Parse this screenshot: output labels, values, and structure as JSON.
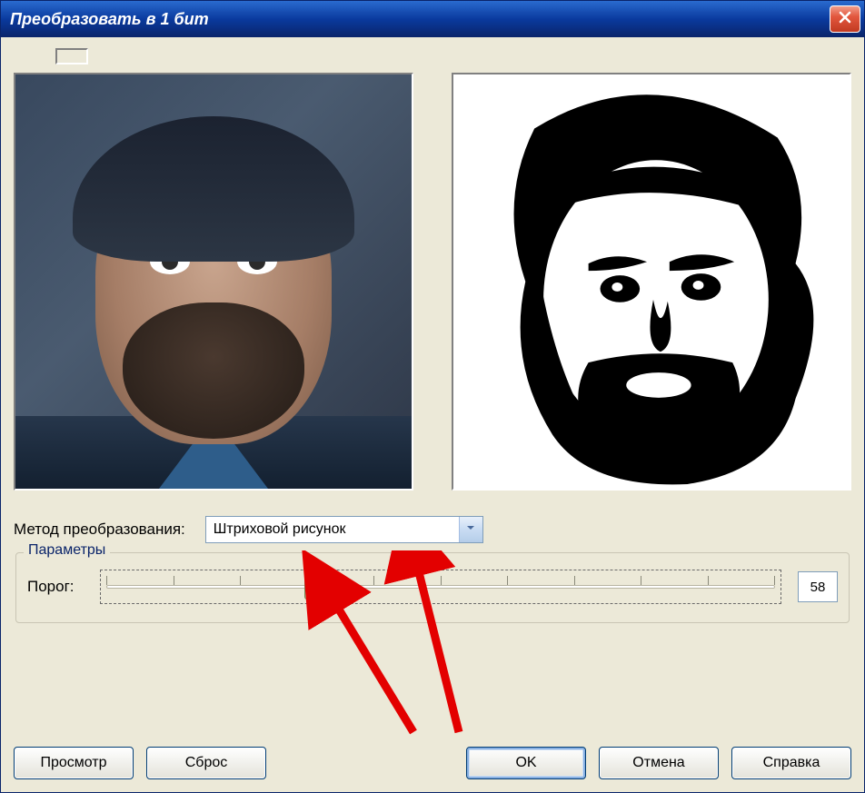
{
  "window": {
    "title": "Преобразовать в 1 бит"
  },
  "controls": {
    "method_label": "Метод преобразования:",
    "method_selected": "Штриховой рисунок"
  },
  "group": {
    "title": "Параметры",
    "threshold_label": "Порог:",
    "threshold_value": "58"
  },
  "buttons": {
    "preview": "Просмотр",
    "reset": "Сброс",
    "ok": "OK",
    "cancel": "Отмена",
    "help": "Справка"
  },
  "icons": {
    "close": "close-icon",
    "chevron_down": "chevron-down-icon"
  },
  "annotations": {
    "arrow1": "red-arrow",
    "arrow2": "red-arrow"
  }
}
